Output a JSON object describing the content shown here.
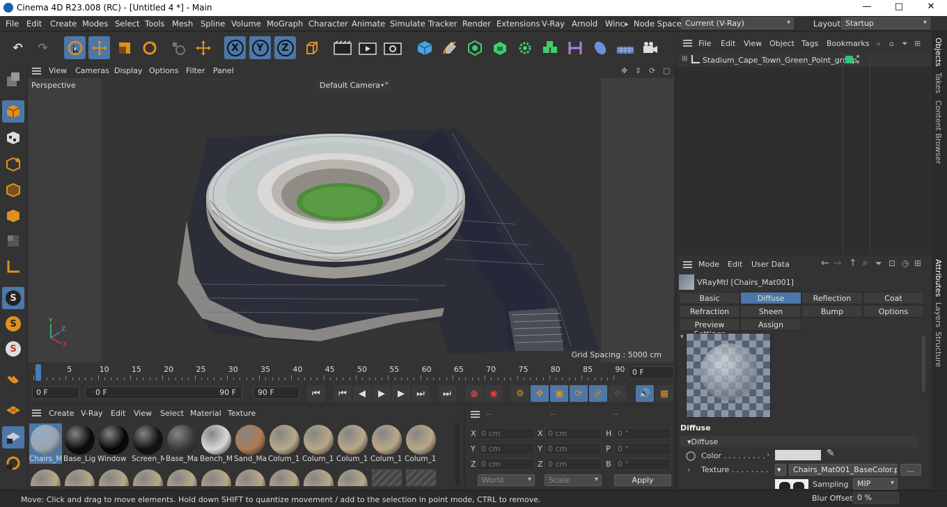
{
  "window": {
    "title": "Cinema 4D R23.008 (RC) - [Untitled 4 *] - Main",
    "minimize": "—",
    "maximize": "□",
    "close": "✕"
  },
  "menubar": {
    "items": [
      "File",
      "Edit",
      "Create",
      "Modes",
      "Select",
      "Tools",
      "Mesh",
      "Spline",
      "Volume",
      "MoGraph",
      "Character",
      "Animate",
      "Simulate",
      "Tracker",
      "Render",
      "Extensions",
      "V-Ray",
      "Arnold",
      "Winc"
    ],
    "more_arrow": "▸",
    "node_space_label": "Node Space:",
    "node_space_value": "Current (V-Ray)",
    "layout_label": "Layout:",
    "layout_value": "Startup"
  },
  "toolbar": {
    "undo": "↶",
    "redo": "↷",
    "x_axis": "X",
    "y_axis": "Y",
    "z_axis": "Z"
  },
  "viewport": {
    "menu": [
      "View",
      "Cameras",
      "Display",
      "Options",
      "Filter",
      "Panel"
    ],
    "projection": "Perspective",
    "camera": "Default Camera",
    "camera_icon": "•°",
    "grid_spacing": "Grid Spacing : 5000 cm",
    "axis_y": "Y",
    "axis_z": "Z",
    "axis_x": "X"
  },
  "timeline": {
    "ticks": [
      "0",
      "5",
      "10",
      "15",
      "20",
      "25",
      "30",
      "35",
      "40",
      "45",
      "50",
      "55",
      "60",
      "65",
      "70",
      "75",
      "80",
      "85",
      "90"
    ],
    "current_frame": "0 F",
    "start_frame": "0 F",
    "range_start": "0 F",
    "range_end": "90 F",
    "end_frame": "90 F"
  },
  "material_manager": {
    "menu": [
      "Create",
      "V-Ray",
      "Edit",
      "View",
      "Select",
      "Material",
      "Texture"
    ],
    "materials": [
      {
        "name": "Chairs_M",
        "color": "#9aa3ad",
        "selected": true
      },
      {
        "name": "Base_Lig",
        "color": "#0a0a0a"
      },
      {
        "name": "Window",
        "color": "#050505"
      },
      {
        "name": "Screen_M",
        "color": "#111111"
      },
      {
        "name": "Base_Ma",
        "color": "#3a3a3a"
      },
      {
        "name": "Bench_M",
        "color": "#d8d8d8"
      },
      {
        "name": "Sand_Ma",
        "color": "#b07a55"
      },
      {
        "name": "Colum_1",
        "color": "#b9a888"
      },
      {
        "name": "Colum_1",
        "color": "#b9a888"
      },
      {
        "name": "Colum_1",
        "color": "#b9a888"
      },
      {
        "name": "Colum_1",
        "color": "#b9a888"
      },
      {
        "name": "Colum_1",
        "color": "#b9a888"
      }
    ]
  },
  "coordinates": {
    "header": [
      "--",
      "--",
      "--"
    ],
    "rows": [
      {
        "a": "X",
        "av": "0 cm",
        "b": "X",
        "bv": "0 cm",
        "c": "H",
        "cv": "0 °"
      },
      {
        "a": "Y",
        "av": "0 cm",
        "b": "Y",
        "bv": "0 cm",
        "c": "P",
        "cv": "0 °"
      },
      {
        "a": "Z",
        "av": "0 cm",
        "b": "Z",
        "bv": "0 cm",
        "c": "B",
        "cv": "0 °"
      }
    ],
    "space": "World",
    "scale": "Scale",
    "apply": "Apply"
  },
  "objects_panel": {
    "menu": [
      "File",
      "Edit",
      "View",
      "Object",
      "Tags",
      "Bookmarks"
    ],
    "objects": [
      {
        "name": "Stadium_Cape_Town_Green_Point_group",
        "tag_color": "#2ec27e"
      }
    ]
  },
  "attributes": {
    "menu": [
      "Mode",
      "Edit",
      "User Data"
    ],
    "material_title": "VRayMtl [Chairs_Mat001]",
    "tabs_row1": [
      "Basic",
      "Diffuse",
      "Reflection",
      "Coat"
    ],
    "tabs_row2": [
      "Refraction",
      "Sheen",
      "Bump",
      "Options"
    ],
    "tabs_row3": [
      "Preview Settings",
      "Assign"
    ],
    "selected_tab": "Diffuse",
    "section": "Diffuse",
    "subsection": "▾Diffuse",
    "color_label": "Color . . . . . . . . .",
    "texture_label": "Texture . . . . . . . .",
    "texture_value": "Chairs_Mat001_BaseColor.p",
    "texture_more": "...",
    "sampling_label": "Sampling",
    "sampling_value": "MIP",
    "blur_label": "Blur Offset",
    "blur_value": "0 %"
  },
  "right_strip": [
    "Objects",
    "Takes",
    "Content Browser",
    "Attributes",
    "Layers",
    "Structure"
  ],
  "status": "Move: Click and drag to move elements. Hold down SHIFT to quantize movement / add to the selection in point mode, CTRL to remove."
}
